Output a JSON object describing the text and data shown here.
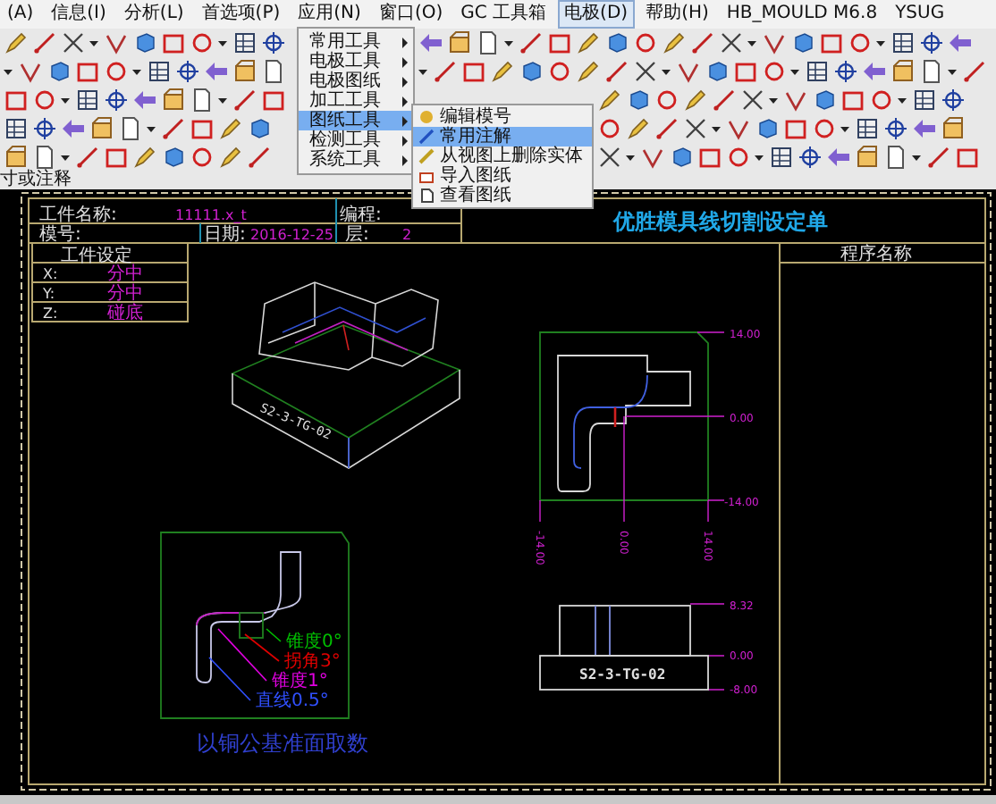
{
  "menu_bar": [
    {
      "label": "(A)",
      "selected": false
    },
    {
      "label": "信息(I)",
      "selected": false
    },
    {
      "label": "分析(L)",
      "selected": false
    },
    {
      "label": "首选项(P)",
      "selected": false
    },
    {
      "label": "应用(N)",
      "selected": false
    },
    {
      "label": "窗口(O)",
      "selected": false
    },
    {
      "label": "GC 工具箱",
      "selected": false
    },
    {
      "label": "电极(D)",
      "selected": true
    },
    {
      "label": "帮助(H)",
      "selected": false
    },
    {
      "label": "HB_MOULD M6.8",
      "selected": false
    },
    {
      "label": "YSUG",
      "selected": false
    }
  ],
  "dropdown_menu": {
    "items": [
      {
        "label": "常用工具",
        "selected": false
      },
      {
        "label": "电极工具",
        "selected": false
      },
      {
        "label": "电极图纸",
        "selected": false
      },
      {
        "label": "加工工具",
        "selected": false
      },
      {
        "label": "图纸工具",
        "selected": true
      },
      {
        "label": "检测工具",
        "selected": false
      },
      {
        "label": "系统工具",
        "selected": false
      }
    ]
  },
  "submenu": {
    "items": [
      {
        "label": "编辑模号",
        "selected": false
      },
      {
        "label": "常用注解",
        "selected": true
      },
      {
        "label": "从视图上删除实体",
        "selected": false
      },
      {
        "label": "导入图纸",
        "selected": false
      },
      {
        "label": "查看图纸",
        "selected": false
      }
    ]
  },
  "command_label": "寸或注释",
  "drawing": {
    "title_block": {
      "title": "优胜模具线切割设定单",
      "fields": [
        {
          "label": "工件名称:",
          "value": "11111.x_t"
        },
        {
          "label": "编程:"
        },
        {
          "label": "模号:"
        },
        {
          "label": "日期:",
          "value": "2016-12-25"
        },
        {
          "label": "层:",
          "value": "2"
        }
      ]
    },
    "work_setup": {
      "heading": "工件设定",
      "rows": [
        {
          "axis": "X:",
          "value": "分中"
        },
        {
          "axis": "Y:",
          "value": "分中"
        },
        {
          "axis": "Z:",
          "value": "碰底"
        }
      ]
    },
    "program_name_heading": "程序名称",
    "part_labels": [
      "S2-3-TG-02",
      "S2-3-TG-02"
    ],
    "top_view_dimensions": [
      "14.00",
      "0.00",
      "-14.00",
      "-14.00",
      "0.00",
      "14.00"
    ],
    "side_view_dimensions": [
      "8.32",
      "0.00",
      "-8.00"
    ],
    "notes": [
      {
        "text": "锥度0°",
        "color": "#00c000"
      },
      {
        "text": "拐角3°",
        "color": "#e00000"
      },
      {
        "text": "锥度1°",
        "color": "#e000e0"
      },
      {
        "text": "直线0.5°",
        "color": "#3050ff"
      }
    ],
    "caption": "以铜公基准面取数"
  }
}
